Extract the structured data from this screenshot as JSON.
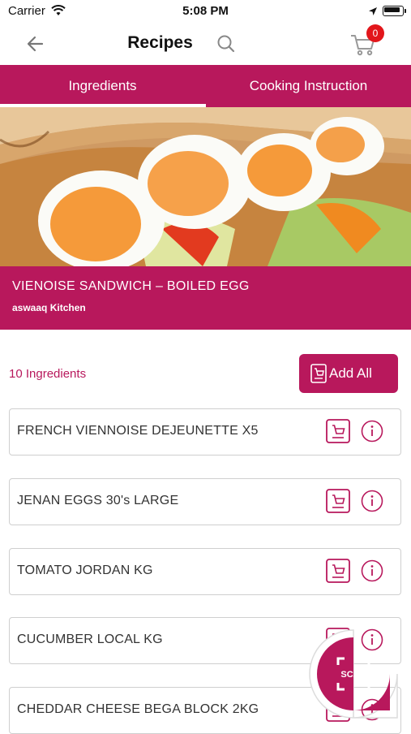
{
  "status_bar": {
    "carrier": "Carrier",
    "time": "5:08 PM"
  },
  "nav": {
    "title": "Recipes",
    "cart_count": "0"
  },
  "tabs": [
    {
      "label": "Ingredients",
      "active": true
    },
    {
      "label": "Cooking Instruction",
      "active": false
    }
  ],
  "recipe": {
    "name": "VIENOISE SANDWICH – BOILED EGG",
    "source": "aswaaq Kitchen"
  },
  "ingredients_count_label": "10 Ingredients",
  "add_all_label": "Add All",
  "ingredients": [
    {
      "name": "FRENCH VIENNOISE DEJEUNETTE X5"
    },
    {
      "name": "JENAN EGGS 30's LARGE"
    },
    {
      "name": "TOMATO JORDAN KG"
    },
    {
      "name": "CUCUMBER LOCAL KG"
    },
    {
      "name": "CHEDDAR CHEESE BEGA BLOCK 2KG"
    }
  ],
  "scan_label": "SCAN",
  "colors": {
    "brand": "#b8185c",
    "badge": "#e2161b",
    "border": "#cfcfcf"
  }
}
